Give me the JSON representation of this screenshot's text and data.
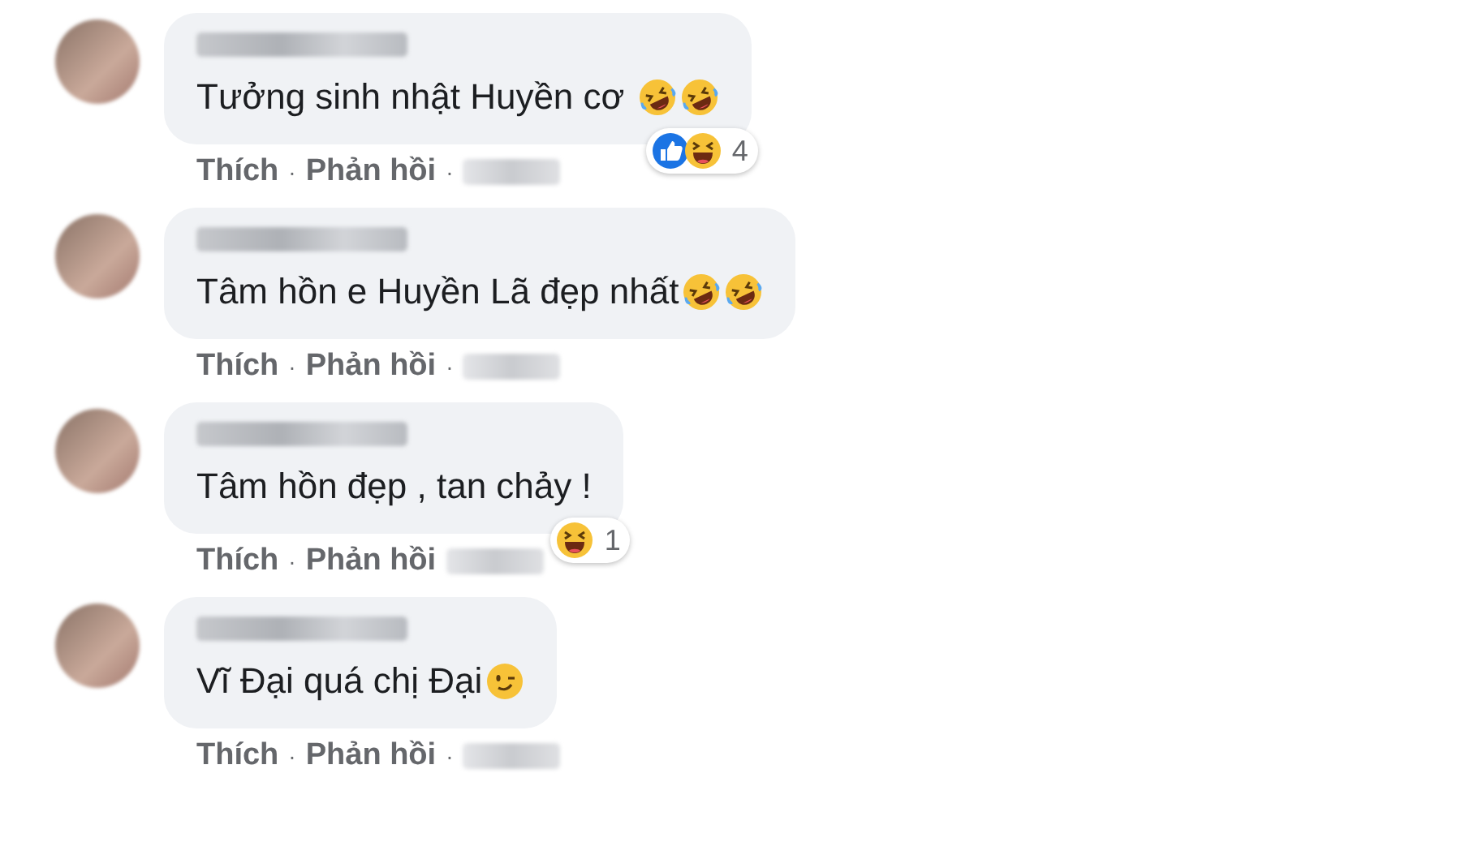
{
  "comments": [
    {
      "text": "Tưởng sinh nhật Huyền cơ ",
      "emoji": [
        {
          "kind": "rofl"
        },
        {
          "kind": "rofl"
        }
      ],
      "reactions": {
        "icons": [
          {
            "kind": "like"
          },
          {
            "kind": "haha"
          }
        ],
        "count": "4"
      },
      "actions": [
        "Thích",
        "·",
        "Phản hồi",
        "·"
      ]
    },
    {
      "text": "Tâm hồn e Huyền Lã đẹp nhất",
      "emoji": [
        {
          "kind": "rofl"
        },
        {
          "kind": "rofl"
        }
      ],
      "actions": [
        "Thích",
        "·",
        "Phản hồi",
        "·"
      ]
    },
    {
      "text": "Tâm hồn đẹp , tan chảy !",
      "reactions": {
        "icons": [
          {
            "kind": "haha"
          }
        ],
        "count": "1"
      },
      "actions": [
        "Thích",
        "·",
        "Phản hồi"
      ]
    },
    {
      "text": "Vĩ Đại quá chị Đại",
      "emoji": [
        {
          "kind": "wink"
        }
      ],
      "actions": [
        "Thích",
        "·",
        "Phản hồi",
        "·"
      ]
    }
  ]
}
